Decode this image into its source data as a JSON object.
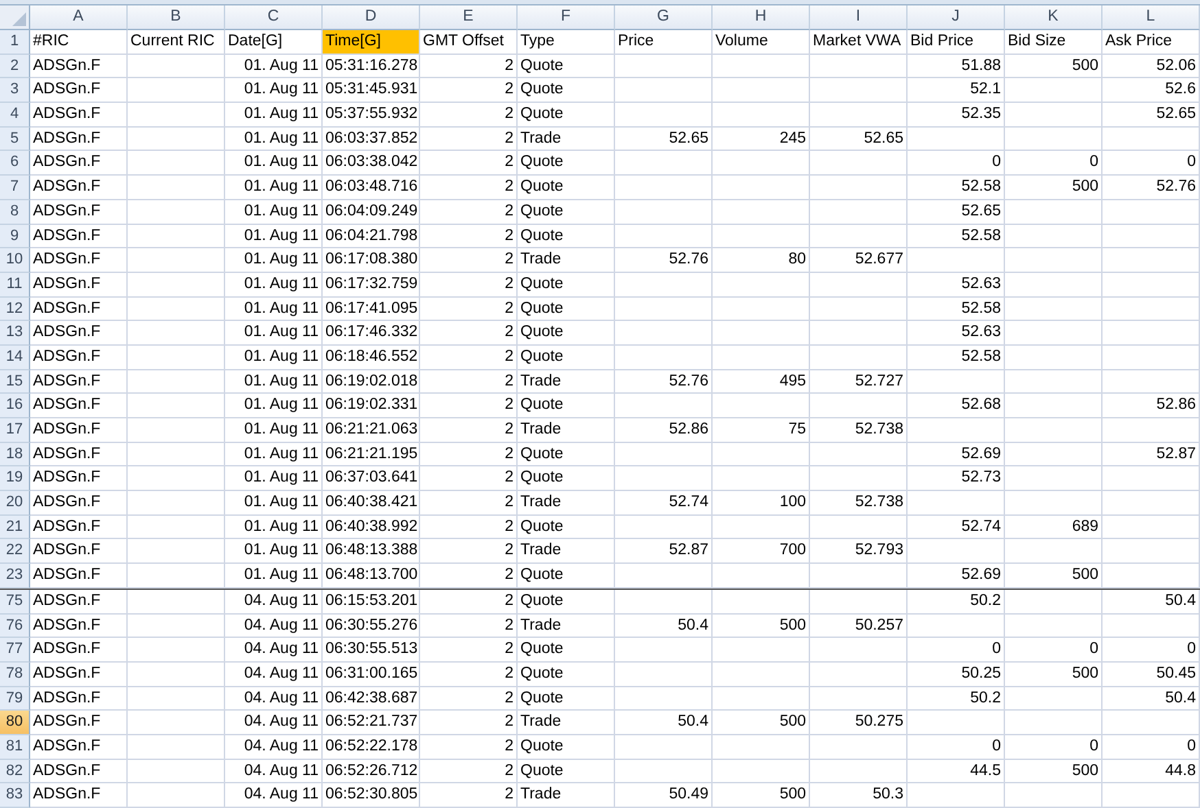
{
  "columns": [
    {
      "letter": "A",
      "kind": "text"
    },
    {
      "letter": "B"
    },
    {
      "letter": "C",
      "kind": "number"
    },
    {
      "letter": "D",
      "kind": "number"
    },
    {
      "letter": "E",
      "kind": "number"
    },
    {
      "letter": "F",
      "kind": "text"
    },
    {
      "letter": "G",
      "kind": "number"
    },
    {
      "letter": "H",
      "kind": "number"
    },
    {
      "letter": "I",
      "kind": "number"
    },
    {
      "letter": "J",
      "kind": "number"
    },
    {
      "letter": "K",
      "kind": "number"
    },
    {
      "letter": "L",
      "kind": "number"
    }
  ],
  "panes": [
    {
      "rows": [
        {
          "number": "1",
          "kind": "header",
          "selected": false,
          "cells": [
            "#RIC",
            "Current RIC",
            "Date[G]",
            {
              "text": "Time[G]",
              "highlighted": true
            },
            "GMT Offset",
            "Type",
            "Price",
            "Volume",
            "Market VWA",
            "Bid Price",
            "Bid Size",
            "Ask Price"
          ]
        },
        {
          "number": "2",
          "kind": "data",
          "selected": false,
          "cells": [
            "ADSGn.F",
            null,
            "01. Aug 11",
            "05:31:16.278",
            "2",
            "Quote",
            null,
            null,
            null,
            "51.88",
            "500",
            "52.06"
          ]
        },
        {
          "number": "3",
          "kind": "data",
          "selected": false,
          "cells": [
            "ADSGn.F",
            null,
            "01. Aug 11",
            "05:31:45.931",
            "2",
            "Quote",
            null,
            null,
            null,
            "52.1",
            null,
            "52.6"
          ]
        },
        {
          "number": "4",
          "kind": "data",
          "selected": false,
          "cells": [
            "ADSGn.F",
            null,
            "01. Aug 11",
            "05:37:55.932",
            "2",
            "Quote",
            null,
            null,
            null,
            "52.35",
            null,
            "52.65"
          ]
        },
        {
          "number": "5",
          "kind": "data",
          "selected": false,
          "cells": [
            "ADSGn.F",
            null,
            "01. Aug 11",
            "06:03:37.852",
            "2",
            "Trade",
            "52.65",
            "245",
            "52.65",
            null,
            null,
            null
          ]
        },
        {
          "number": "6",
          "kind": "data",
          "selected": false,
          "cells": [
            "ADSGn.F",
            null,
            "01. Aug 11",
            "06:03:38.042",
            "2",
            "Quote",
            null,
            null,
            null,
            "0",
            "0",
            "0"
          ]
        },
        {
          "number": "7",
          "kind": "data",
          "selected": false,
          "cells": [
            "ADSGn.F",
            null,
            "01. Aug 11",
            "06:03:48.716",
            "2",
            "Quote",
            null,
            null,
            null,
            "52.58",
            "500",
            "52.76"
          ]
        },
        {
          "number": "8",
          "kind": "data",
          "selected": false,
          "cells": [
            "ADSGn.F",
            null,
            "01. Aug 11",
            "06:04:09.249",
            "2",
            "Quote",
            null,
            null,
            null,
            "52.65",
            null,
            null
          ]
        },
        {
          "number": "9",
          "kind": "data",
          "selected": false,
          "cells": [
            "ADSGn.F",
            null,
            "01. Aug 11",
            "06:04:21.798",
            "2",
            "Quote",
            null,
            null,
            null,
            "52.58",
            null,
            null
          ]
        },
        {
          "number": "10",
          "kind": "data",
          "selected": false,
          "cells": [
            "ADSGn.F",
            null,
            "01. Aug 11",
            "06:17:08.380",
            "2",
            "Trade",
            "52.76",
            "80",
            "52.677",
            null,
            null,
            null
          ]
        },
        {
          "number": "11",
          "kind": "data",
          "selected": false,
          "cells": [
            "ADSGn.F",
            null,
            "01. Aug 11",
            "06:17:32.759",
            "2",
            "Quote",
            null,
            null,
            null,
            "52.63",
            null,
            null
          ]
        },
        {
          "number": "12",
          "kind": "data",
          "selected": false,
          "cells": [
            "ADSGn.F",
            null,
            "01. Aug 11",
            "06:17:41.095",
            "2",
            "Quote",
            null,
            null,
            null,
            "52.58",
            null,
            null
          ]
        },
        {
          "number": "13",
          "kind": "data",
          "selected": false,
          "cells": [
            "ADSGn.F",
            null,
            "01. Aug 11",
            "06:17:46.332",
            "2",
            "Quote",
            null,
            null,
            null,
            "52.63",
            null,
            null
          ]
        },
        {
          "number": "14",
          "kind": "data",
          "selected": false,
          "cells": [
            "ADSGn.F",
            null,
            "01. Aug 11",
            "06:18:46.552",
            "2",
            "Quote",
            null,
            null,
            null,
            "52.58",
            null,
            null
          ]
        },
        {
          "number": "15",
          "kind": "data",
          "selected": false,
          "cells": [
            "ADSGn.F",
            null,
            "01. Aug 11",
            "06:19:02.018",
            "2",
            "Trade",
            "52.76",
            "495",
            "52.727",
            null,
            null,
            null
          ]
        },
        {
          "number": "16",
          "kind": "data",
          "selected": false,
          "cells": [
            "ADSGn.F",
            null,
            "01. Aug 11",
            "06:19:02.331",
            "2",
            "Quote",
            null,
            null,
            null,
            "52.68",
            null,
            "52.86"
          ]
        },
        {
          "number": "17",
          "kind": "data",
          "selected": false,
          "cells": [
            "ADSGn.F",
            null,
            "01. Aug 11",
            "06:21:21.063",
            "2",
            "Trade",
            "52.86",
            "75",
            "52.738",
            null,
            null,
            null
          ]
        },
        {
          "number": "18",
          "kind": "data",
          "selected": false,
          "cells": [
            "ADSGn.F",
            null,
            "01. Aug 11",
            "06:21:21.195",
            "2",
            "Quote",
            null,
            null,
            null,
            "52.69",
            null,
            "52.87"
          ]
        },
        {
          "number": "19",
          "kind": "data",
          "selected": false,
          "cells": [
            "ADSGn.F",
            null,
            "01. Aug 11",
            "06:37:03.641",
            "2",
            "Quote",
            null,
            null,
            null,
            "52.73",
            null,
            null
          ]
        },
        {
          "number": "20",
          "kind": "data",
          "selected": false,
          "cells": [
            "ADSGn.F",
            null,
            "01. Aug 11",
            "06:40:38.421",
            "2",
            "Trade",
            "52.74",
            "100",
            "52.738",
            null,
            null,
            null
          ]
        },
        {
          "number": "21",
          "kind": "data",
          "selected": false,
          "cells": [
            "ADSGn.F",
            null,
            "01. Aug 11",
            "06:40:38.992",
            "2",
            "Quote",
            null,
            null,
            null,
            "52.74",
            "689",
            null
          ]
        },
        {
          "number": "22",
          "kind": "data",
          "selected": false,
          "cells": [
            "ADSGn.F",
            null,
            "01. Aug 11",
            "06:48:13.388",
            "2",
            "Trade",
            "52.87",
            "700",
            "52.793",
            null,
            null,
            null
          ]
        },
        {
          "number": "23",
          "kind": "data",
          "selected": false,
          "cells": [
            "ADSGn.F",
            null,
            "01. Aug 11",
            "06:48:13.700",
            "2",
            "Quote",
            null,
            null,
            null,
            "52.69",
            "500",
            null
          ]
        }
      ]
    },
    {
      "rows": [
        {
          "number": "75",
          "kind": "data",
          "selected": false,
          "cells": [
            "ADSGn.F",
            null,
            "04. Aug 11",
            "06:15:53.201",
            "2",
            "Quote",
            null,
            null,
            null,
            "50.2",
            null,
            "50.4"
          ]
        },
        {
          "number": "76",
          "kind": "data",
          "selected": false,
          "cells": [
            "ADSGn.F",
            null,
            "04. Aug 11",
            "06:30:55.276",
            "2",
            "Trade",
            "50.4",
            "500",
            "50.257",
            null,
            null,
            null
          ]
        },
        {
          "number": "77",
          "kind": "data",
          "selected": false,
          "cells": [
            "ADSGn.F",
            null,
            "04. Aug 11",
            "06:30:55.513",
            "2",
            "Quote",
            null,
            null,
            null,
            "0",
            "0",
            "0"
          ]
        },
        {
          "number": "78",
          "kind": "data",
          "selected": false,
          "cells": [
            "ADSGn.F",
            null,
            "04. Aug 11",
            "06:31:00.165",
            "2",
            "Quote",
            null,
            null,
            null,
            "50.25",
            "500",
            "50.45"
          ]
        },
        {
          "number": "79",
          "kind": "data",
          "selected": false,
          "cells": [
            "ADSGn.F",
            null,
            "04. Aug 11",
            "06:42:38.687",
            "2",
            "Quote",
            null,
            null,
            null,
            "50.2",
            null,
            "50.4"
          ]
        },
        {
          "number": "80",
          "kind": "data",
          "selected": true,
          "cells": [
            "ADSGn.F",
            null,
            "04. Aug 11",
            "06:52:21.737",
            "2",
            "Trade",
            "50.4",
            "500",
            "50.275",
            null,
            null,
            null
          ]
        },
        {
          "number": "81",
          "kind": "data",
          "selected": false,
          "cells": [
            "ADSGn.F",
            null,
            "04. Aug 11",
            "06:52:22.178",
            "2",
            "Quote",
            null,
            null,
            null,
            "0",
            "0",
            "0"
          ]
        },
        {
          "number": "82",
          "kind": "data",
          "selected": false,
          "cells": [
            "ADSGn.F",
            null,
            "04. Aug 11",
            "06:52:26.712",
            "2",
            "Quote",
            null,
            null,
            null,
            "44.5",
            "500",
            "44.8"
          ]
        },
        {
          "number": "83",
          "kind": "data",
          "selected": false,
          "cells": [
            "ADSGn.F",
            null,
            "04. Aug 11",
            "06:52:30.805",
            "2",
            "Trade",
            "50.49",
            "500",
            "50.3",
            null,
            null,
            null
          ]
        }
      ]
    }
  ]
}
